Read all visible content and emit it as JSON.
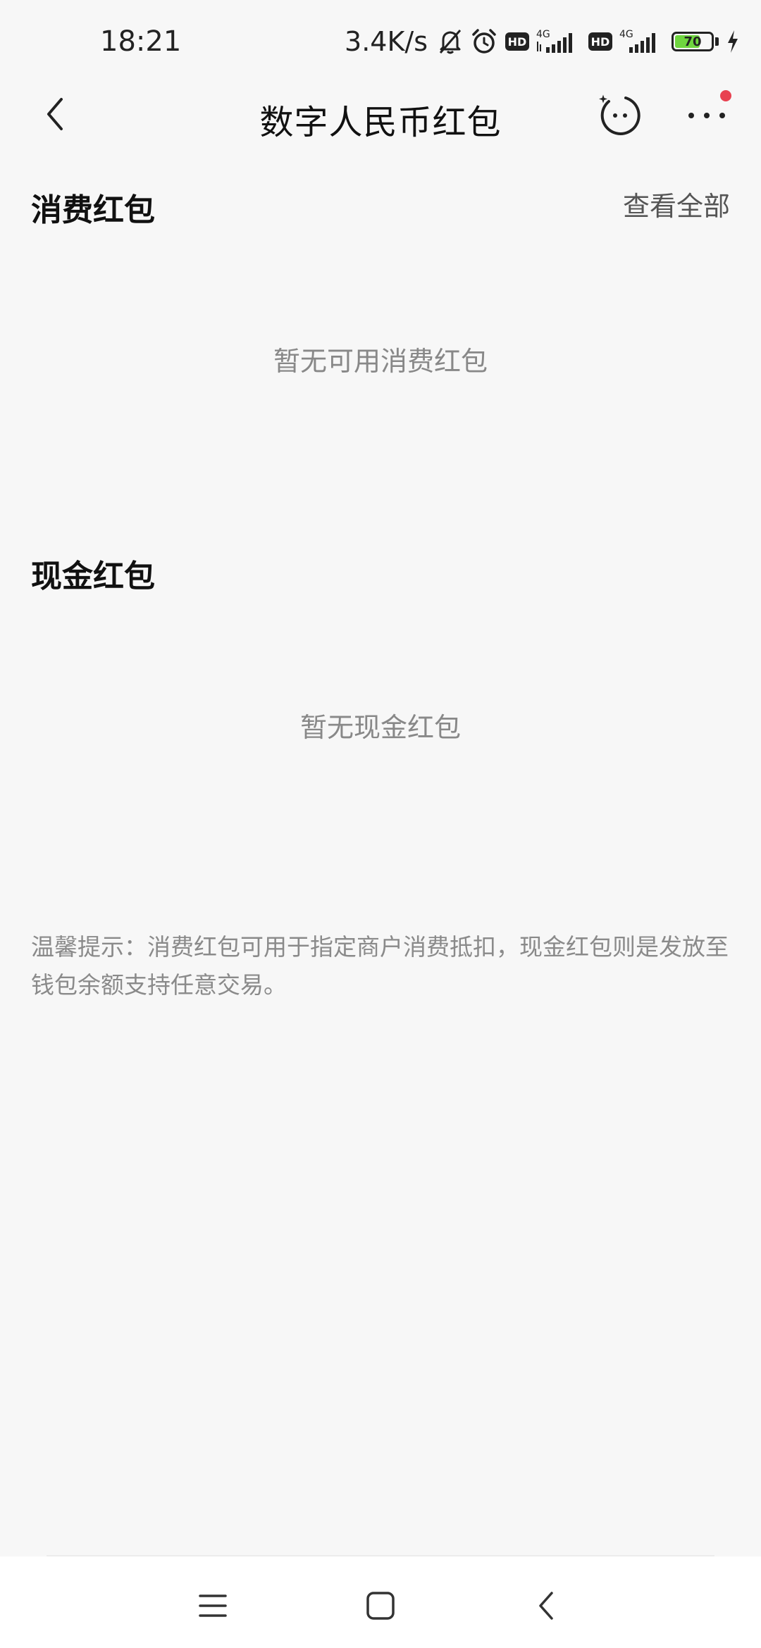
{
  "status_bar": {
    "time": "18:21",
    "network_speed": "3.4K/s",
    "network_type_1": "4G",
    "network_type_2": "4G",
    "hd_label_1": "HD",
    "hd_label_2": "HD",
    "battery_level": "70",
    "battery_fraction": 0.7,
    "icons": [
      "mute-bell-icon",
      "alarm-icon",
      "signal-icon",
      "charging-bolt-icon"
    ]
  },
  "header": {
    "title": "数字人民币红包",
    "back_icon": "chevron-left-icon",
    "assistant_icon": "smiley-sparkle-icon",
    "more_icon": "more-dots-icon",
    "notification_dot_color": "#e84150"
  },
  "consumption_section": {
    "title": "消费红包",
    "view_all_label": "查看全部",
    "empty_text": "暂无可用消费红包"
  },
  "cash_section": {
    "title": "现金红包",
    "empty_text": "暂无现金红包"
  },
  "tip": {
    "text": "温馨提示：消费红包可用于指定商户消费抵扣，现金红包则是发放至钱包余额支持任意交易。"
  },
  "nav_bar": {
    "icons": [
      "menu-icon",
      "home-square-icon",
      "back-chevron-icon"
    ]
  }
}
